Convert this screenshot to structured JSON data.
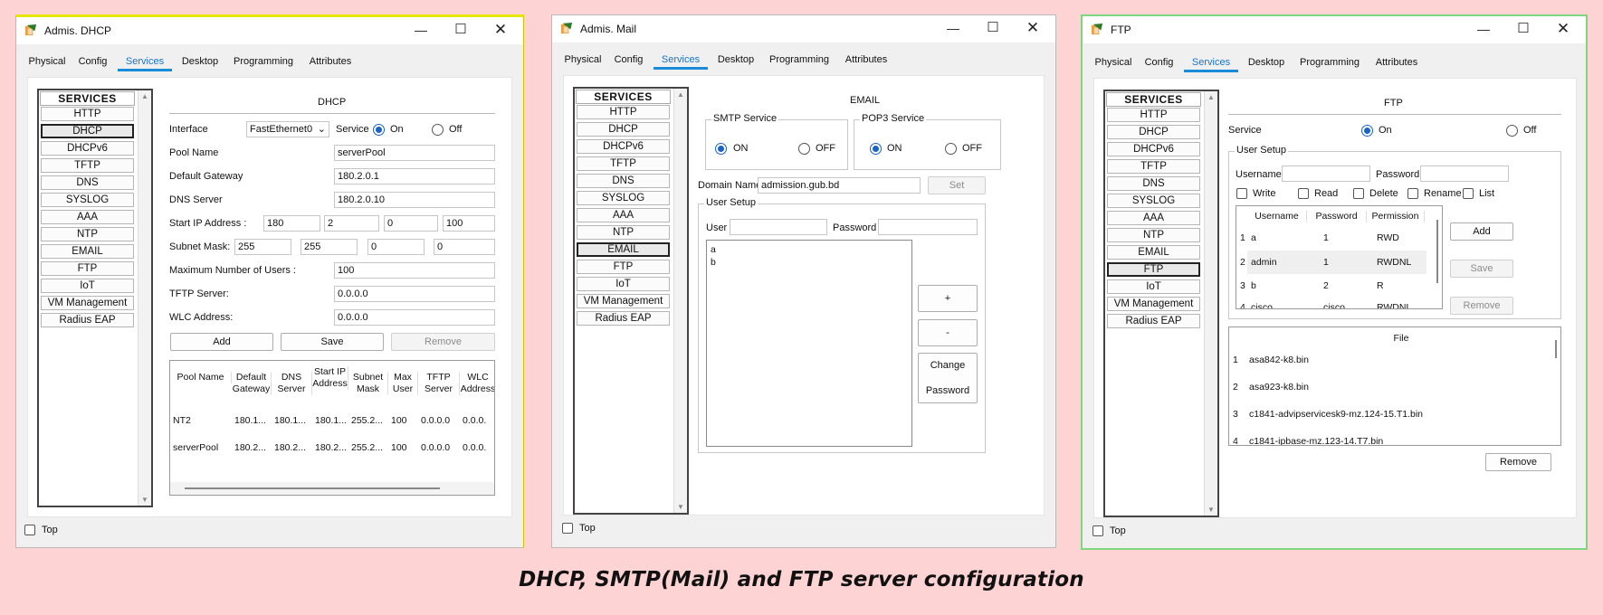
{
  "tabs": [
    "Physical",
    "Config",
    "Services",
    "Desktop",
    "Programming",
    "Attributes"
  ],
  "services": {
    "header": "SERVICES",
    "items": [
      "HTTP",
      "DHCP",
      "DHCPv6",
      "TFTP",
      "DNS",
      "SYSLOG",
      "AAA",
      "NTP",
      "EMAIL",
      "FTP",
      "IoT",
      "VM Management",
      "Radius EAP"
    ]
  },
  "top_label": "Top",
  "dhcp": {
    "title": "Admis. DHCP",
    "section": "DHCP",
    "interface_label": "Interface",
    "interface_value": "FastEthernet0",
    "service_label": "Service",
    "on": "On",
    "off": "Off",
    "pool_name_label": "Pool Name",
    "pool_name": "serverPool",
    "gateway_label": "Default Gateway",
    "gateway": "180.2.0.1",
    "dns_label": "DNS Server",
    "dns": "180.2.0.10",
    "start_ip_label": "Start IP Address :",
    "start_ip": [
      "180",
      "2",
      "0",
      "100"
    ],
    "mask_label": "Subnet Mask:",
    "mask": [
      "255",
      "255",
      "0",
      "0"
    ],
    "max_users_label": "Maximum Number of Users :",
    "max_users": "100",
    "tftp_label": "TFTP Server:",
    "tftp": "0.0.0.0",
    "wlc_label": "WLC Address:",
    "wlc": "0.0.0.0",
    "add": "Add",
    "save": "Save",
    "remove": "Remove",
    "table_headers": [
      "Pool Name",
      "Default Gateway",
      "DNS Server",
      "Start IP Address",
      "Subnet Mask",
      "Max User",
      "TFTP Server",
      "WLC Address"
    ],
    "rows": [
      [
        "NT2",
        "180.1...",
        "180.1...",
        "180.1...",
        "255.2...",
        "100",
        "0.0.0.0",
        "0.0.0."
      ],
      [
        "serverPool",
        "180.2...",
        "180.2...",
        "180.2...",
        "255.2...",
        "100",
        "0.0.0.0",
        "0.0.0."
      ]
    ]
  },
  "mail": {
    "title": "Admis. Mail",
    "section": "EMAIL",
    "smtp_label": "SMTP Service",
    "pop3_label": "POP3 Service",
    "on": "ON",
    "off": "OFF",
    "domain_label": "Domain Name:",
    "domain": "admission.gub.bd",
    "set": "Set",
    "user_setup": "User Setup",
    "user_label": "User",
    "password_label": "Password",
    "users": [
      "a",
      "b"
    ],
    "plus": "+",
    "minus": "-",
    "change": "Change",
    "password_btn": "Password"
  },
  "ftp": {
    "title": "FTP",
    "section": "FTP",
    "service_label": "Service",
    "on": "On",
    "off": "Off",
    "user_setup": "User Setup",
    "username_label": "Username",
    "password_label": "Password",
    "perms": [
      "Write",
      "Read",
      "Delete",
      "Rename",
      "List"
    ],
    "table_headers": [
      "Username",
      "Password",
      "Permission"
    ],
    "users": [
      {
        "n": "1",
        "u": "a",
        "p": "1",
        "perm": "RWD"
      },
      {
        "n": "2",
        "u": "admin",
        "p": "1",
        "perm": "RWDNL"
      },
      {
        "n": "3",
        "u": "b",
        "p": "2",
        "perm": "R"
      },
      {
        "n": "4",
        "u": "cisco",
        "p": "cisco",
        "perm": "RWDNL"
      }
    ],
    "add": "Add",
    "save": "Save",
    "remove": "Remove",
    "file_header": "File",
    "files": [
      {
        "n": "1",
        "f": "asa842-k8.bin"
      },
      {
        "n": "2",
        "f": "asa923-k8.bin"
      },
      {
        "n": "3",
        "f": "c1841-advipservicesk9-mz.124-15.T1.bin"
      },
      {
        "n": "4",
        "f": "c1841-ipbase-mz.123-14.T7.bin"
      }
    ],
    "file_remove": "Remove"
  },
  "caption": "DHCP, SMTP(Mail) and FTP server configuration",
  "colors": {
    "background": "#fdd3d3",
    "accent": "#1a8bd6",
    "radio": "#1a62c6"
  }
}
